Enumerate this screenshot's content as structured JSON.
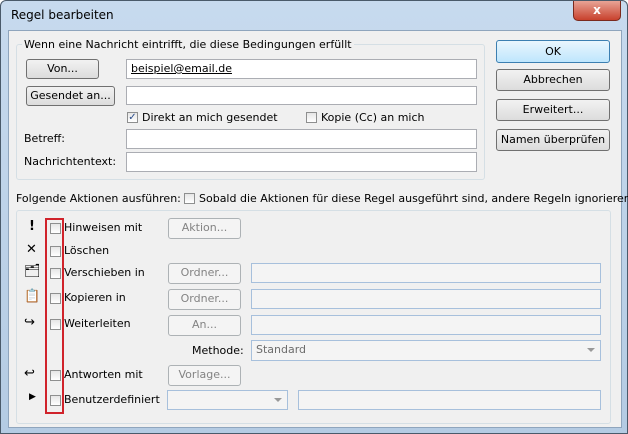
{
  "window": {
    "title": "Regel bearbeiten",
    "close": "x"
  },
  "conditions": {
    "legend": "Wenn eine Nachricht eintrifft, die diese Bedingungen erfüllt",
    "from_button": "Von...",
    "from_value": "beispiel@email.de",
    "sent_to_button": "Gesendet an...",
    "sent_to_value": "",
    "direct_label": "Direkt an mich gesendet",
    "direct_checked": true,
    "cc_label": "Kopie (Cc) an mich",
    "cc_checked": false,
    "subject_label": "Betreff:",
    "subject_value": "",
    "body_label": "Nachrichtentext:",
    "body_value": ""
  },
  "buttons": {
    "ok": "OK",
    "cancel": "Abbrechen",
    "advanced": "Erweitert...",
    "check_names": "Namen überprüfen"
  },
  "actions": {
    "heading": "Folgende Aktionen ausführen:",
    "stop_label": "Sobald die Aktionen für diese Regel ausgeführt sind, andere Regeln ignorieren",
    "notify": {
      "label": "Hinweisen mit",
      "button": "Aktion..."
    },
    "delete": {
      "label": "Löschen"
    },
    "move": {
      "label": "Verschieben in",
      "button": "Ordner...",
      "value": ""
    },
    "copy": {
      "label": "Kopieren in",
      "button": "Ordner...",
      "value": ""
    },
    "forward": {
      "label": "Weiterleiten",
      "button": "An...",
      "value": ""
    },
    "method_label": "Methode:",
    "method_value": "Standard",
    "reply": {
      "label": "Antworten mit",
      "button": "Vorlage..."
    },
    "custom": {
      "label": "Benutzerdefiniert",
      "select": "",
      "value": ""
    }
  },
  "highlight_color": "#d0232b"
}
